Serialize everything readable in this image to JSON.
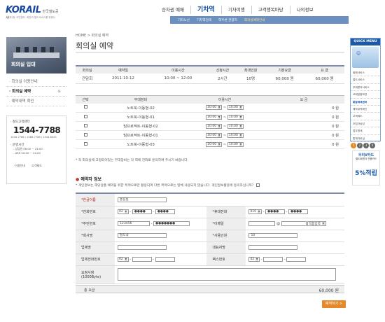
{
  "header": {
    "brand": "KORAIL",
    "brand_kor": "한국철도공사",
    "tagline": "세계1등 국민철도, 희망의 철도서비스를 위해서",
    "nav": [
      "승차권 예매",
      "기차역",
      "기차여행",
      "고객행복마당",
      "나의정보"
    ],
    "active_nav": "기차역",
    "subnav": [
      "기차노선",
      "기차역검색",
      "역주변 관광지",
      "회의실예약안내"
    ]
  },
  "left": {
    "banner_label": "회의실 입대",
    "menu": [
      "· 회의실 이용안내",
      "· 회의실 예약",
      "· 예약내역 확인"
    ],
    "active_menu_index": 1,
    "cs": {
      "title": "· 철도고객센터",
      "number": "1544-7788",
      "sub": "1544-7788 / 1588-7788 / 1544-8545",
      "hours_title": "· 운영시간",
      "hours": [
        "- 상담원   06:00 ~ 24:00",
        "- ARS      00:00 ~ 24:00"
      ],
      "links": [
        "·이용안내",
        "·고객제도"
      ]
    }
  },
  "main": {
    "breadcrumb": "HOME > 회의실 예약",
    "title": "회의실 예약",
    "room_table": {
      "headers": [
        "회의실",
        "예약일",
        "이용시간",
        "신청시간",
        "최대인원",
        "기본요금",
        "요 금"
      ],
      "row": [
        "간담회",
        "2011-10-12",
        "10:00 ~ 12:00",
        "2시간",
        "10명",
        "60,000 원",
        "60,000 원"
      ]
    },
    "equip_table": {
      "headers": [
        "선택",
        "부대장비",
        "이용시간",
        "요 금"
      ],
      "rows": [
        {
          "name": "노트북-이동형-02",
          "start": "10:00",
          "end": "10:00",
          "fee": "0 원"
        },
        {
          "name": "노트북-이동형-01",
          "start": "10:00",
          "end": "10:00",
          "fee": "0 원"
        },
        {
          "name": "빔프로젝트-이동형-02",
          "start": "10:00",
          "end": "10:00",
          "fee": "0 원"
        },
        {
          "name": "빔프로젝트-이동형-01",
          "start": "10:00",
          "end": "10:00",
          "fee": "0 원"
        },
        {
          "name": "노트북-이동형-03",
          "start": "10:00",
          "end": "10:00",
          "fee": "0 원"
        }
      ]
    },
    "equip_note": "* 각 회의실에 고정되어있는 부대장비는 각 역에 전화로 문의하여 주시기 바랍니다.",
    "info_heading": "예약자 정보",
    "privacy_note": "* 개인정보는 해당상품 예약을 위한 목적으로만 활용되며 다른 목적으로는 일체 사용되지 않습니다. 개인정보활용에 동의하십니까?",
    "form": {
      "name_label": "*한글이름",
      "name_value": "홍길동",
      "phone_label": "*전화번호",
      "phone_area": "02",
      "phone_mid": "●●●●",
      "phone_last": "●●●●",
      "mobile_label": "*휴대전화",
      "mobile_pre": "010",
      "mobile_mid": "●●●●",
      "mobile_last": "●●●●",
      "rrn_label": "*주민번호",
      "rrn_front": "123456",
      "rrn_back": "●●●●●●●",
      "email_label": "*이메일",
      "email_at": "@",
      "email_select": "직접입력",
      "company_label": "*회사명",
      "company_value": "철도국",
      "attendees_label": "*사용인원",
      "attendees_value": "10",
      "biz_label": "업체명",
      "ceo_label": "대표자명",
      "bizphone_label": "업체전화번호",
      "bizphone_area": "02",
      "fax_label": "팩스번호",
      "fax_area": "02",
      "request_label": "요청사항",
      "request_hint": "(1000Byte)"
    },
    "total_label": "총 요금",
    "total_value": "60,000 원",
    "submit_label": "예약하기 >"
  },
  "quick": {
    "title": "QUICK MENU",
    "items": [
      "회원서비스",
      "철도서비스",
      "부대편의서비스",
      "코레일홍보관",
      "통합예매센터",
      "예약내역확인",
      "고객제도",
      "조립자상담",
      "업무명세",
      "통계자료실"
    ],
    "active_index": 4,
    "pages": [
      "1",
      "2",
      "3",
      "4"
    ],
    "promo_title": "우리V카드",
    "promo_sub": "철도회원자 전용카드",
    "promo_pct": "5%적립"
  }
}
